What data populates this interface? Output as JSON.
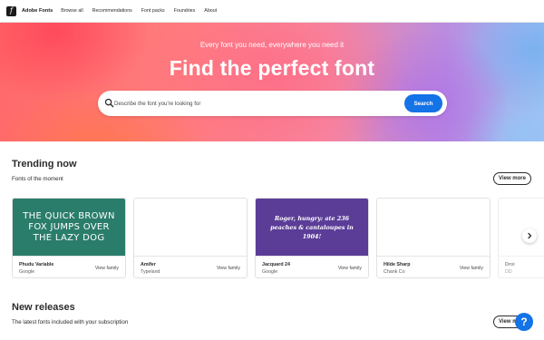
{
  "nav": {
    "logo_glyph": "f",
    "brand": "Adobe Fonts",
    "items": [
      "Browse all",
      "Recommendations",
      "Font packs",
      "Foundries",
      "About"
    ]
  },
  "hero": {
    "subtitle": "Every font you need, everywhere you need it",
    "title": "Find the perfect font",
    "search_placeholder": "Describe the font you're looking for",
    "search_button": "Search"
  },
  "trending": {
    "title": "Trending now",
    "subtitle": "Fonts of the moment",
    "view_more": "View more",
    "cards": [
      {
        "preview": "THE QUICK BROWN FOX JUMPS OVER THE LAZY DOG",
        "preview_bg": "#2a7d6b",
        "name": "Phudu Variable",
        "foundry": "Google",
        "link": "View family"
      },
      {
        "preview": "",
        "preview_bg": "#ffffff",
        "name": "Amifer",
        "foundry": "Typeland",
        "link": "View family"
      },
      {
        "preview": "Roger, hungry: ate 236 peaches & cantaloupes in 1904!",
        "preview_bg": "#5b3d98",
        "name": "Jacquard 24",
        "foundry": "Google",
        "link": "View family"
      },
      {
        "preview": "",
        "preview_bg": "#ffffff",
        "name": "Hilde Sharp",
        "foundry": "Chank Co",
        "link": "View family"
      },
      {
        "preview": "",
        "preview_bg": "#ffffff",
        "name": "Droi",
        "foundry": "DD",
        "link": ""
      }
    ]
  },
  "new_releases": {
    "title": "New releases",
    "subtitle": "The latest fonts included with your subscription",
    "view_more": "View m"
  },
  "help": {
    "label": "?"
  },
  "colors": {
    "accent": "#1473e6",
    "text": "#2c2c2c"
  }
}
